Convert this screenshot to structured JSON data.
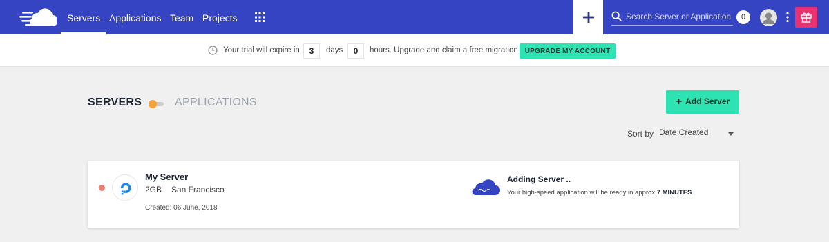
{
  "nav": {
    "items": [
      {
        "label": "Servers",
        "active": true
      },
      {
        "label": "Applications"
      },
      {
        "label": "Team"
      },
      {
        "label": "Projects"
      }
    ],
    "search_placeholder": "Search Server or Application",
    "notification_count": "0",
    "icons": [
      "logo-cloud-icon",
      "apps-grid-icon",
      "plus-icon",
      "search-icon",
      "avatar-icon",
      "kebab-menu-icon",
      "gift-icon"
    ],
    "colors": {
      "bar": "#3544c3",
      "gift": "#e83270"
    }
  },
  "trial": {
    "prefix": "Your trial will expire in",
    "days_value": "3",
    "days_label": "days",
    "hours_value": "0",
    "hours_label": "hours. Upgrade and claim a free migration",
    "upgrade_button": "UPGRADE MY ACCOUNT"
  },
  "view": {
    "tab_servers": "SERVERS",
    "tab_applications": "APPLICATIONS",
    "add_server": "Add Server",
    "sort_label": "Sort by",
    "sort_value": "Date Created",
    "accent": "#2de3b1"
  },
  "server": {
    "name": "My Server",
    "size": "2GB",
    "location": "San Francisco",
    "created": "Created: 06 June, 2018",
    "status_color": "#f27f70",
    "adding_title": "Adding Server ..",
    "adding_desc": "Your high-speed application will be ready in approx",
    "adding_eta": "7 MINUTES"
  }
}
